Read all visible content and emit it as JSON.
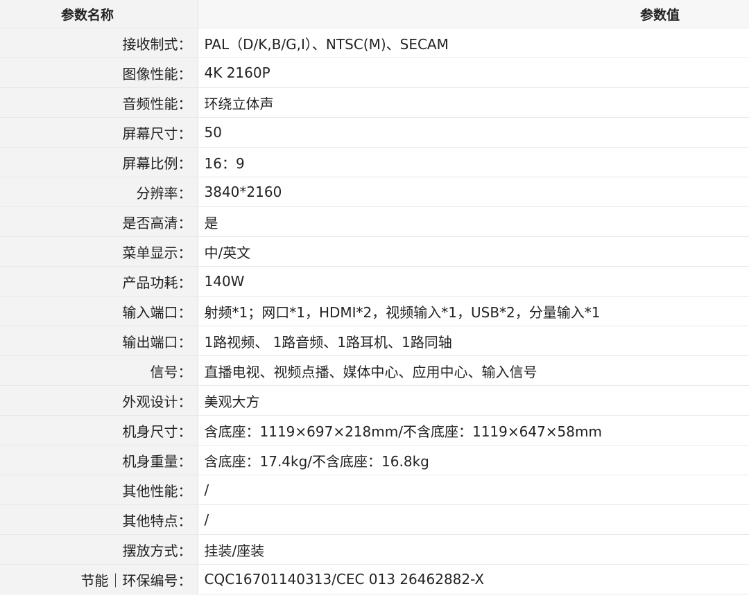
{
  "header": {
    "name": "参数名称",
    "value": "参数值"
  },
  "rows": [
    {
      "k": "接收制式：",
      "v": "PAL（D/K,B/G,I）、NTSC(M)、SECAM"
    },
    {
      "k": "图像性能：",
      "v": "4K 2160P"
    },
    {
      "k": "音频性能：",
      "v": "环绕立体声"
    },
    {
      "k": "屏幕尺寸：",
      "v": "50"
    },
    {
      "k": "屏幕比例：",
      "v": "16：9"
    },
    {
      "k": "分辨率：",
      "v": "3840*2160"
    },
    {
      "k": "是否高清：",
      "v": "是"
    },
    {
      "k": "菜单显示：",
      "v": "中/英文"
    },
    {
      "k": "产品功耗：",
      "v": "140W"
    },
    {
      "k": "输入端口：",
      "v": "射频*1；网口*1，HDMI*2，视频输入*1，USB*2，分量输入*1"
    },
    {
      "k": "输出端口：",
      "v": "1路视频、 1路音频、1路耳机、1路同轴"
    },
    {
      "k": "信号：",
      "v": "直播电视、视频点播、媒体中心、应用中心、输入信号"
    },
    {
      "k": "外观设计：",
      "v": "美观大方"
    },
    {
      "k": "机身尺寸：",
      "v": "含底座：1119×697×218mm/不含底座：1119×647×58mm"
    },
    {
      "k": "机身重量：",
      "v": "含底座：17.4kg/不含底座：16.8kg"
    },
    {
      "k": "其他性能：",
      "v": "/"
    },
    {
      "k": "其他特点：",
      "v": "/"
    },
    {
      "k": "摆放方式：",
      "v": "挂装/座装"
    },
    {
      "k": "节能｜环保编号：",
      "v": "CQC16701140313/CEC 013 26462882-X"
    }
  ]
}
